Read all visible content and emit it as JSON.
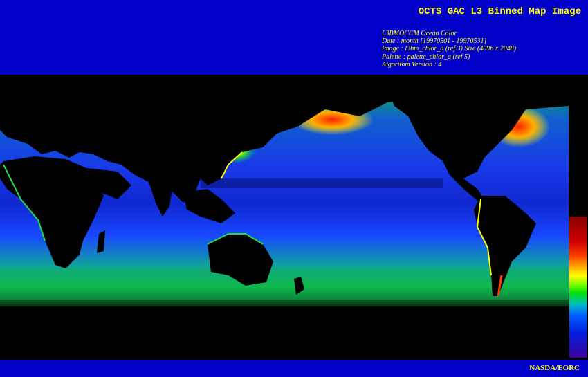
{
  "header": {
    "title": "OCTS GAC L3 Binned Map Image",
    "meta_lines": [
      "L3BMOCCM Ocean Color",
      "Date : month [19970501 - 19970531]",
      "Image : l3bm_chlor_a (ref 3) Size (4096 x 2048)",
      "Palette : palette_chlor_a (ref 5)",
      "Algorithm Version : 4"
    ]
  },
  "map": {
    "colors": {
      "background": "#000000",
      "land": "#000000",
      "ocean_low": "#1030e0",
      "ocean_mid": "#00a0ff",
      "coastal_high": "#00e040",
      "bloom": "#ffff00",
      "very_high": "#ff2000"
    }
  },
  "colorbar": {
    "palette": [
      "#8b0000",
      "#cc0000",
      "#ff4000",
      "#ffb000",
      "#ffff00",
      "#80ff00",
      "#00e000",
      "#00c0c0",
      "#0060ff",
      "#0020e0",
      "#4000a0"
    ]
  },
  "footer": {
    "credit": "NASDA/EORC"
  },
  "colors": {
    "header_bg": "#0000c8",
    "header_text": "#ffff00"
  }
}
